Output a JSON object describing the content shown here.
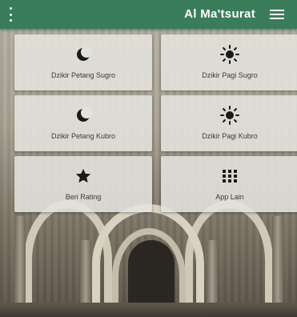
{
  "app": {
    "title": "Al Ma'tsurat",
    "accent": "#3a7d5a"
  },
  "appbar": {
    "menu_icon": "hamburger-menu-icon",
    "overflow_icon": "kebab-menu-icon"
  },
  "menu": [
    {
      "label": "Dzikir Petang Sugro",
      "icon": "crescent-moon-icon"
    },
    {
      "label": "Dzikir Pagi Sugro",
      "icon": "sun-icon"
    },
    {
      "label": "Dzikir Petang Kubro",
      "icon": "crescent-moon-icon"
    },
    {
      "label": "Dzikir Pagi Kubro",
      "icon": "sun-icon"
    },
    {
      "label": "Beri Rating",
      "icon": "star-icon"
    },
    {
      "label": "App Lain",
      "icon": "grid-apps-icon"
    }
  ]
}
